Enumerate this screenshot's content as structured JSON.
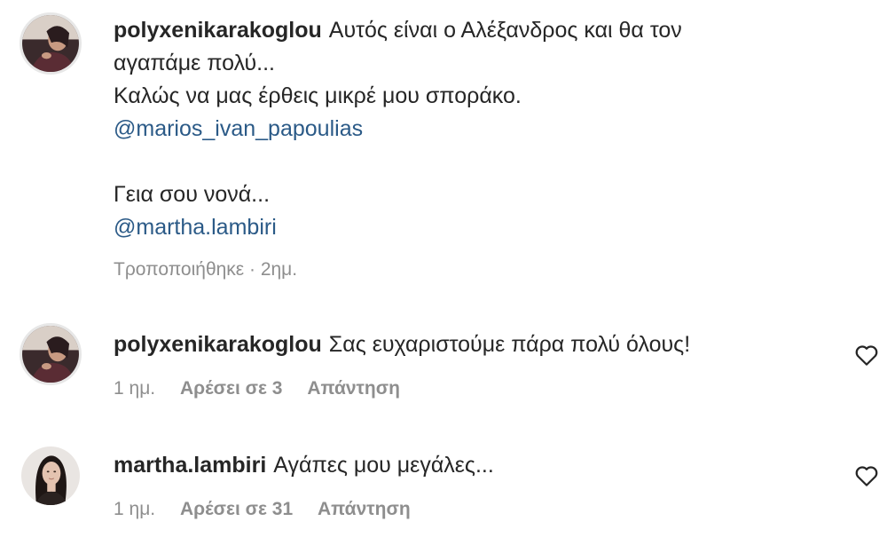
{
  "comments": [
    {
      "username": "polyxenikarakoglou",
      "lines": [
        "Αυτός είναι ο Αλέξανδρος και θα τον",
        "αγαπάμε πολύ...",
        "Καλώς να μας έρθεις μικρέ μου σποράκο.",
        "@marios_ivan_papoulias",
        "Γεια σου νονά...",
        "@martha.lambiri"
      ],
      "meta": {
        "edited": "Τροποποιήθηκε · 2ημ."
      }
    },
    {
      "username": "polyxenikarakoglou",
      "text": "Σας ευχαριστούμε πάρα πολύ όλους!",
      "meta": {
        "time": "1 ημ.",
        "likes": "Αρέσει σε 3",
        "reply": "Απάντηση"
      }
    },
    {
      "username": "martha.lambiri",
      "text": "Αγάπες μου μεγάλες...",
      "meta": {
        "time": "1 ημ.",
        "likes": "Αρέσει σε 31",
        "reply": "Απάντηση"
      }
    }
  ],
  "icons": {
    "like": "heart-outline-icon",
    "avatar": "profile-photo"
  },
  "colors": {
    "text": "#262626",
    "mention": "#2b5a87",
    "meta": "#8e8e8e"
  }
}
